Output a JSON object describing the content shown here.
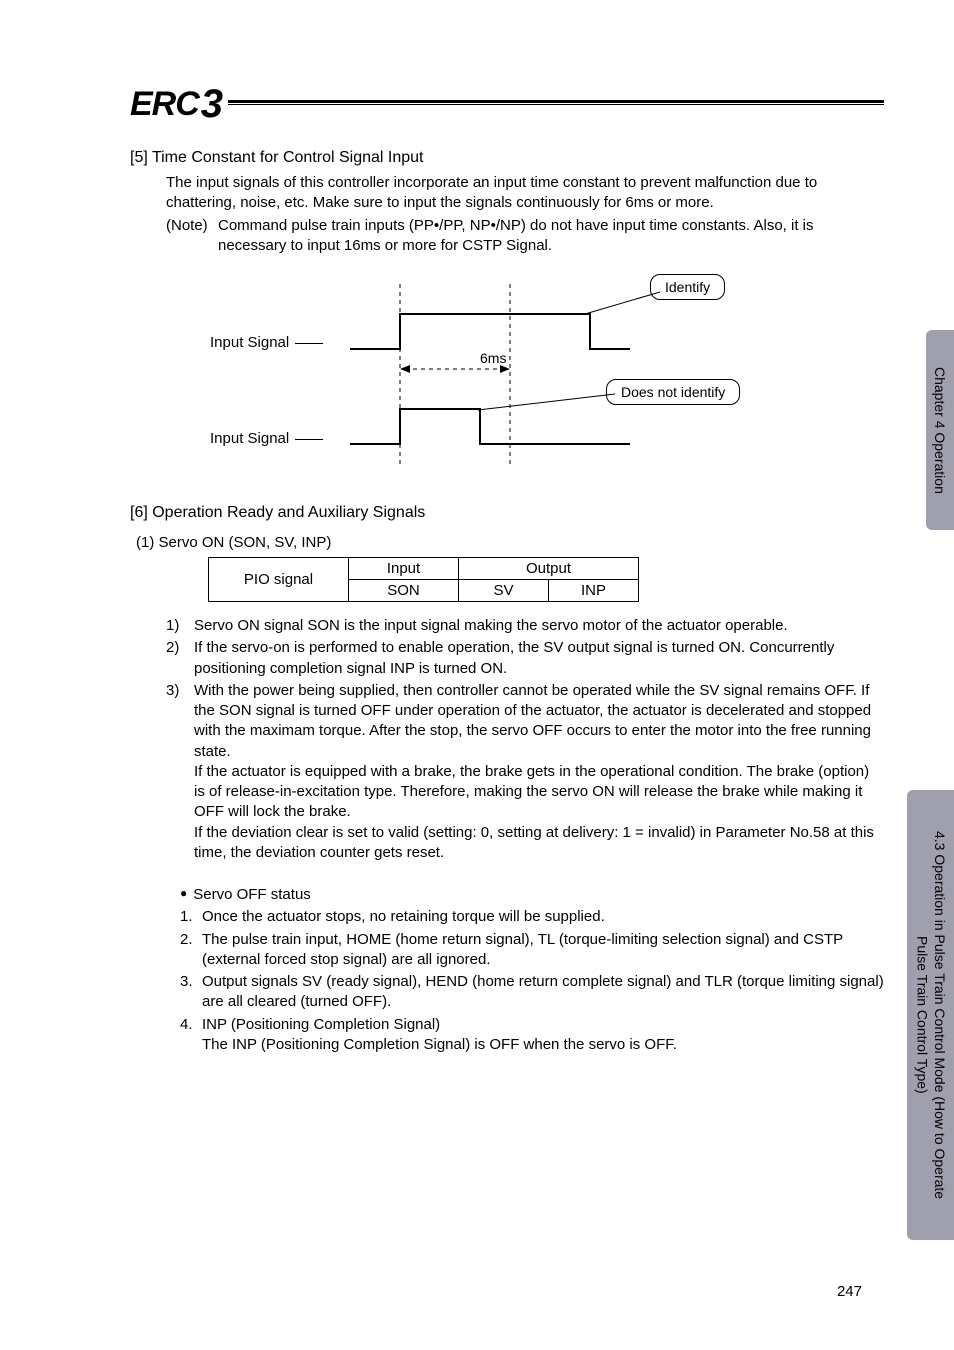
{
  "logo": {
    "text": "ERC",
    "numeral": "3"
  },
  "side": {
    "tab1": "Chapter 4 Operation",
    "tab2": "4.3 Operation in Pulse Train Control Mode (How to Operate\nPulse Train Control Type)"
  },
  "sec5": {
    "heading": "[5]  Time Constant for Control Signal Input",
    "p1": "The input signals of this controller incorporate an input time constant to prevent malfunction due to chattering, noise, etc. Make sure to input the signals continuously for 6ms or more.",
    "note_label": "(Note)",
    "note_body": "Command pulse train inputs (PP•/PP, NP•/NP) do not have input time constants. Also, it is necessary to input 16ms or more for CSTP Signal."
  },
  "diagram": {
    "input_signal_top": "Input Signal",
    "input_signal_bot": "Input Signal",
    "six_ms": "6ms",
    "identify": "Identify",
    "does_not_identify": "Does not identify"
  },
  "sec6": {
    "heading": "[6]  Operation Ready and Auxiliary Signals",
    "sub1": "(1) Servo ON (SON, SV, INP)",
    "table": {
      "pio_signal": "PIO signal",
      "input": "Input",
      "output": "Output",
      "son": "SON",
      "sv": "SV",
      "inp": "INP"
    },
    "list": {
      "i1": "Servo ON signal SON is the input signal making the servo motor of the actuator operable.",
      "i2": "If the servo-on is performed to enable operation, the SV output signal is turned ON. Concurrently positioning completion signal INP is turned ON.",
      "i3a": "With the power being supplied, then controller cannot be operated while the SV signal remains OFF. If the SON signal is turned OFF under operation of the actuator, the actuator is decelerated and stopped with the maximam torque. After the stop, the servo OFF occurs to enter the motor into the free running state.",
      "i3b": "If the actuator is equipped with a brake, the brake gets in the operational condition. The brake (option) is of release-in-excitation type. Therefore, making the servo ON will release the brake while making it OFF will lock the brake.",
      "i3c": "If the deviation clear is set to valid (setting: 0, setting at delivery: 1 = invalid) in Parameter No.58 at this time, the deviation counter gets reset."
    },
    "servo_off": {
      "head": "Servo OFF status",
      "r1": "Once the actuator stops, no retaining torque will be supplied.",
      "r2": "The pulse train input, HOME (home return signal), TL (torque-limiting selection signal) and CSTP (external forced stop signal) are all ignored.",
      "r3": "Output signals SV (ready signal), HEND (home return complete signal) and TLR (torque limiting signal) are all cleared (turned OFF).",
      "r4a": "INP (Positioning Completion Signal)",
      "r4b": "The INP (Positioning Completion Signal) is OFF when the servo is OFF."
    }
  },
  "page_number": "247"
}
